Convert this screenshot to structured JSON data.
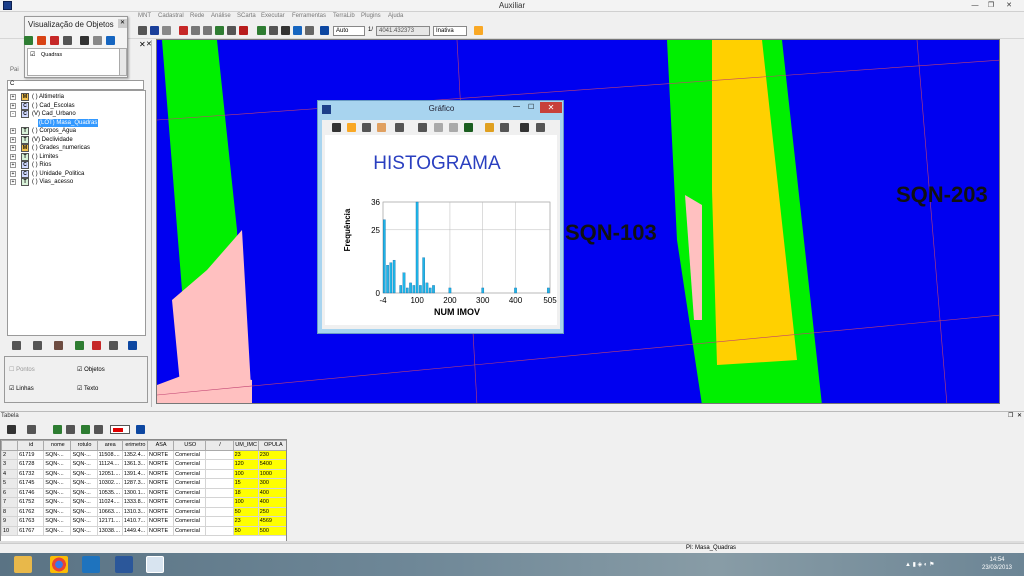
{
  "window": {
    "title": "Auxiliar"
  },
  "menu": {
    "items": [
      "MNT",
      "Cadastral",
      "Rede",
      "Análise",
      "SCarta",
      "Executar",
      "Ferramentas",
      "TerraLib",
      "Plugins",
      "Ajuda"
    ]
  },
  "toolbar": {
    "combo_auto": "Auto",
    "scale_prefix": "1/",
    "scale_value": "4041.432373",
    "combo_status": "Inativa"
  },
  "left_panel": {
    "label_short": "Pai",
    "objects_window_title": "Visualização de Objetos",
    "objects_item": "Quadras",
    "layers": [
      {
        "icon": "M",
        "label": "( ) Altimetria",
        "expand": "+"
      },
      {
        "icon": "C",
        "label": "( ) Cad_Escolas",
        "expand": "+"
      },
      {
        "icon": "C",
        "label": "(V) Cad_Urbano",
        "expand": "-"
      },
      {
        "icon": "",
        "label": "(LOT) Masa_Quadras",
        "expand": "",
        "selected": true
      },
      {
        "icon": "T",
        "label": "( ) Corpos_Agua",
        "expand": "+"
      },
      {
        "icon": "T",
        "label": "(V) Declividade",
        "expand": "+"
      },
      {
        "icon": "M",
        "label": "( ) Grades_numericas",
        "expand": "+"
      },
      {
        "icon": "T",
        "label": "( ) Limites",
        "expand": "+"
      },
      {
        "icon": "C",
        "label": "( ) Rios",
        "expand": "+"
      },
      {
        "icon": "C",
        "label": "( ) Unidade_Politica",
        "expand": "+"
      },
      {
        "icon": "T",
        "label": "( ) Vias_acesso",
        "expand": "+"
      }
    ],
    "checks": [
      {
        "label": "Pontos",
        "checked": false
      },
      {
        "label": "Objetos",
        "checked": true
      },
      {
        "label": "Linhas",
        "checked": true
      },
      {
        "label": "Texto",
        "checked": true
      }
    ]
  },
  "map": {
    "labels": [
      "SQN-103",
      "SQN-203"
    ],
    "colors": {
      "background": "#0000f0",
      "green": "#00f000",
      "yellow": "#ffd000",
      "pink": "#ffc0c0"
    }
  },
  "grafico": {
    "window_title": "Gráfico",
    "chart_data": {
      "type": "bar",
      "title": "HISTOGRAMA",
      "xlabel": "NUM  IMOV",
      "ylabel": "Frequência",
      "xlim": [
        -4,
        505
      ],
      "ylim": [
        0,
        36
      ],
      "xticks": [
        "-4",
        "100",
        "200",
        "300",
        "400",
        "505"
      ],
      "yticks": [
        "0",
        "25",
        "36"
      ],
      "bins": [
        {
          "x": 0,
          "value": 29
        },
        {
          "x": 10,
          "value": 11
        },
        {
          "x": 20,
          "value": 12
        },
        {
          "x": 30,
          "value": 13
        },
        {
          "x": 50,
          "value": 3
        },
        {
          "x": 60,
          "value": 8
        },
        {
          "x": 70,
          "value": 2
        },
        {
          "x": 80,
          "value": 4
        },
        {
          "x": 90,
          "value": 3
        },
        {
          "x": 100,
          "value": 36
        },
        {
          "x": 110,
          "value": 3
        },
        {
          "x": 120,
          "value": 14
        },
        {
          "x": 130,
          "value": 4
        },
        {
          "x": 140,
          "value": 2
        },
        {
          "x": 150,
          "value": 3
        },
        {
          "x": 200,
          "value": 2
        },
        {
          "x": 300,
          "value": 2
        },
        {
          "x": 400,
          "value": 2
        },
        {
          "x": 500,
          "value": 2
        }
      ]
    }
  },
  "tabela": {
    "title": "Tabela",
    "columns": [
      "",
      "id",
      "nome",
      "rotulo",
      "area",
      "erimetro",
      "ASA",
      "USO",
      "/",
      "UM_IMC",
      "OPULA"
    ],
    "rows": [
      [
        "2",
        "61719",
        "SQN-...",
        "SQN-...",
        "11508....",
        "1352.4...",
        "NORTE",
        "Comercial",
        "",
        "23",
        "230"
      ],
      [
        "3",
        "61728",
        "SQN-...",
        "SQN-...",
        "11124....",
        "1361.3...",
        "NORTE",
        "Comercial",
        "",
        "120",
        "5400"
      ],
      [
        "4",
        "61732",
        "SQN-...",
        "SQN-...",
        "12051....",
        "1391.4...",
        "NORTE",
        "Comercial",
        "",
        "100",
        "1000"
      ],
      [
        "5",
        "61745",
        "SQN-...",
        "SQN-...",
        "10302....",
        "1287.3...",
        "NORTE",
        "Comercial",
        "",
        "15",
        "300"
      ],
      [
        "6",
        "61746",
        "SQN-...",
        "SQN-...",
        "10535....",
        "1300.1...",
        "NORTE",
        "Comercial",
        "",
        "18",
        "400"
      ],
      [
        "7",
        "61752",
        "SQN-...",
        "SQN-...",
        "11024....",
        "1333.8...",
        "NORTE",
        "Comercial",
        "",
        "100",
        "400"
      ],
      [
        "8",
        "61762",
        "SQN-...",
        "SQN-...",
        "10663....",
        "1310.3...",
        "NORTE",
        "Comercial",
        "",
        "50",
        "250"
      ],
      [
        "9",
        "61763",
        "SQN-...",
        "SQN-...",
        "12171....",
        "1410.7...",
        "NORTE",
        "Comercial",
        "",
        "23",
        "4569"
      ],
      [
        "10",
        "61767",
        "SQN-...",
        "SQN-...",
        "13038....",
        "1449.4...",
        "NORTE",
        "Comercial",
        "",
        "50",
        "500"
      ]
    ]
  },
  "status": {
    "text": "PI: Masa_Quadras"
  },
  "clock": {
    "time": "14:54",
    "date": "23/03/2013"
  }
}
